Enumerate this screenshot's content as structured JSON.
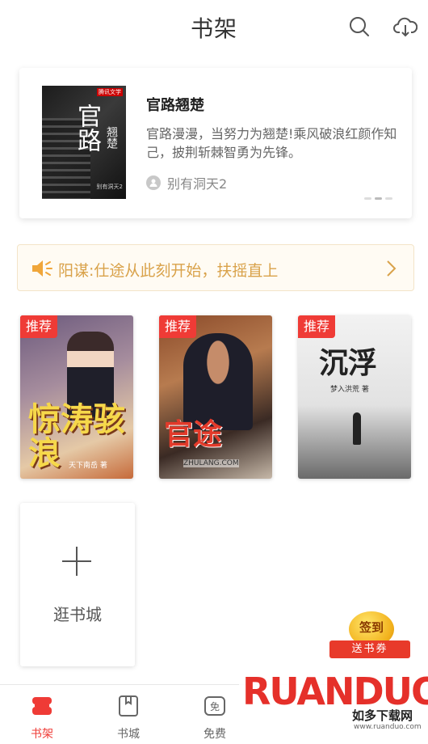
{
  "header": {
    "title": "书架",
    "search_icon": "search-icon",
    "cloud_icon": "cloud-download-icon"
  },
  "featured": {
    "cover_title": "官路",
    "cover_title_2": "翘楚",
    "cover_logo": "腾讯文学",
    "cover_author": "别有洞天2",
    "title": "官路翘楚",
    "description": "官路漫漫，当努力为翘楚!乘风破浪红颜作知己，披荆斩棘智勇为先锋。",
    "author": "别有洞天2"
  },
  "notice": {
    "text": "阳谋:仕途从此刻开始，扶摇直上"
  },
  "books": [
    {
      "badge": "推荐",
      "cover_title": "惊涛骇浪",
      "cover_sub": "天下南岳 著"
    },
    {
      "badge": "推荐",
      "cover_title": "官途",
      "cover_sub": "ZHULANG.COM"
    },
    {
      "badge": "推荐",
      "cover_title": "沉浮",
      "cover_sub": "梦入洪荒 著"
    }
  ],
  "add_card": {
    "label": "逛书城"
  },
  "signin": {
    "coin": "签到",
    "ribbon": "送书券"
  },
  "bottom_nav": [
    {
      "label": "书架",
      "active": true
    },
    {
      "label": "书城",
      "active": false
    },
    {
      "label": "免费",
      "active": false
    }
  ],
  "watermark": {
    "logo": "RUANDUO",
    "cn": "如多下载网",
    "url": "www.ruanduo.com"
  },
  "colors": {
    "accent": "#ef3b36",
    "notice_text": "#d9a24a",
    "notice_bg": "#fffbf3"
  }
}
